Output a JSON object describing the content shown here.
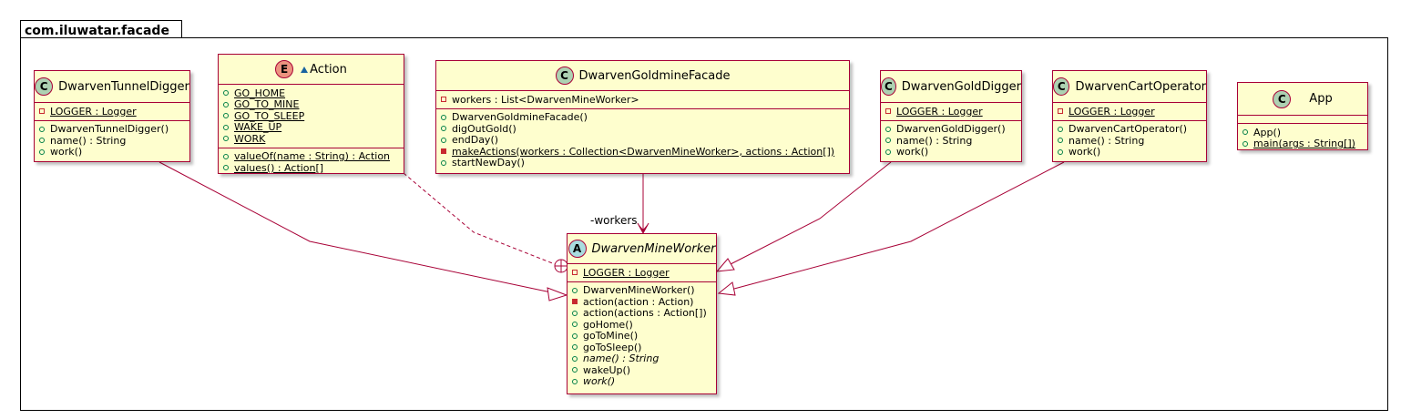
{
  "package": {
    "name": "com.iluwatar.facade"
  },
  "classes": {
    "tunnel_digger": {
      "name": "DwarvenTunnelDigger",
      "stereotype_icon": "C",
      "fields": [
        {
          "vis": "private",
          "text": "LOGGER : Logger",
          "static": true
        }
      ],
      "methods": [
        {
          "vis": "public",
          "text": "DwarvenTunnelDigger()"
        },
        {
          "vis": "public",
          "text": "name() : String"
        },
        {
          "vis": "public",
          "text": "work()"
        }
      ]
    },
    "action": {
      "name": "Action",
      "stereotype_icon": "E",
      "visibility_icon": "package-triangle-icon",
      "fields": [
        {
          "vis": "public",
          "text": "GO_HOME",
          "static": true
        },
        {
          "vis": "public",
          "text": "GO_TO_MINE",
          "static": true
        },
        {
          "vis": "public",
          "text": "GO_TO_SLEEP",
          "static": true
        },
        {
          "vis": "public",
          "text": "WAKE_UP",
          "static": true
        },
        {
          "vis": "public",
          "text": "WORK",
          "static": true
        }
      ],
      "methods": [
        {
          "vis": "public",
          "text": "valueOf(name : String) : Action",
          "static": true
        },
        {
          "vis": "public",
          "text": "values() : Action[]",
          "static": true
        }
      ]
    },
    "facade": {
      "name": "DwarvenGoldmineFacade",
      "stereotype_icon": "C",
      "fields": [
        {
          "vis": "private",
          "text": "workers : List<DwarvenMineWorker>"
        }
      ],
      "methods": [
        {
          "vis": "public",
          "text": "DwarvenGoldmineFacade()"
        },
        {
          "vis": "public",
          "text": "digOutGold()"
        },
        {
          "vis": "public",
          "text": "endDay()"
        },
        {
          "vis": "private",
          "text": "makeActions(workers : Collection<DwarvenMineWorker>, actions : Action[])",
          "static": true
        },
        {
          "vis": "public",
          "text": "startNewDay()"
        }
      ]
    },
    "gold_digger": {
      "name": "DwarvenGoldDigger",
      "stereotype_icon": "C",
      "fields": [
        {
          "vis": "private",
          "text": "LOGGER : Logger",
          "static": true
        }
      ],
      "methods": [
        {
          "vis": "public",
          "text": "DwarvenGoldDigger()"
        },
        {
          "vis": "public",
          "text": "name() : String"
        },
        {
          "vis": "public",
          "text": "work()"
        }
      ]
    },
    "cart_operator": {
      "name": "DwarvenCartOperator",
      "stereotype_icon": "C",
      "fields": [
        {
          "vis": "private",
          "text": "LOGGER : Logger",
          "static": true
        }
      ],
      "methods": [
        {
          "vis": "public",
          "text": "DwarvenCartOperator()"
        },
        {
          "vis": "public",
          "text": "name() : String"
        },
        {
          "vis": "public",
          "text": "work()"
        }
      ]
    },
    "app": {
      "name": "App",
      "stereotype_icon": "C",
      "methods": [
        {
          "vis": "public",
          "text": "App()"
        },
        {
          "vis": "public",
          "text": "main(args : String[])",
          "static": true
        }
      ]
    },
    "mine_worker": {
      "name": "DwarvenMineWorker",
      "stereotype_icon": "A",
      "abstract": true,
      "fields": [
        {
          "vis": "private",
          "text": "LOGGER : Logger",
          "static": true
        }
      ],
      "methods": [
        {
          "vis": "public",
          "text": "DwarvenMineWorker()"
        },
        {
          "vis": "private",
          "text": "action(action : Action)"
        },
        {
          "vis": "public",
          "text": "action(actions : Action[])"
        },
        {
          "vis": "public",
          "text": "goHome()"
        },
        {
          "vis": "public",
          "text": "goToMine()"
        },
        {
          "vis": "public",
          "text": "goToSleep()"
        },
        {
          "vis": "public",
          "text": "name() : String",
          "abstract": true
        },
        {
          "vis": "public",
          "text": "wakeUp()"
        },
        {
          "vis": "public",
          "text": "work()",
          "abstract": true
        }
      ]
    }
  },
  "relations": {
    "workers_label": "-workers"
  },
  "colors": {
    "class_fill": "#fefece",
    "class_border": "#a80036",
    "class_badge": "#add1b2",
    "enum_badge": "#eb937f",
    "abstract_badge": "#a9dcdf",
    "public_vis": "#038048",
    "private_vis": "#c82930",
    "link": "#a80036"
  }
}
